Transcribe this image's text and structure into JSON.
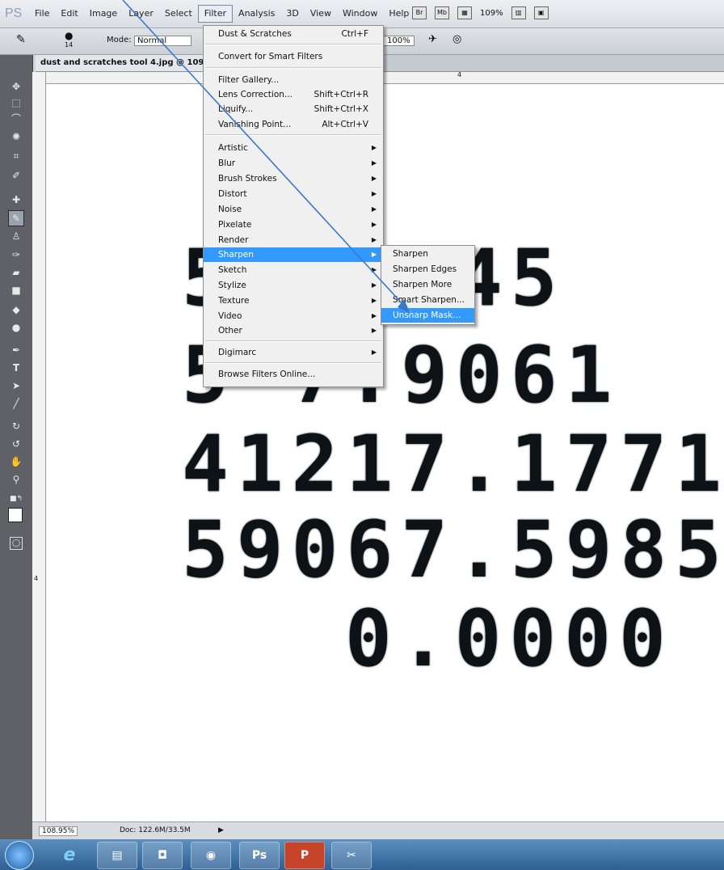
{
  "app": {
    "logo": "PS"
  },
  "menubar": {
    "items": [
      "File",
      "Edit",
      "Image",
      "Layer",
      "Select",
      "Filter",
      "Analysis",
      "3D",
      "View",
      "Window",
      "Help"
    ],
    "active": "Filter",
    "icons": {
      "br": "Br",
      "mb": "Mb"
    },
    "zoom": "109%"
  },
  "options": {
    "brush_size": "14",
    "mode_label": "Mode:",
    "mode_value": "Normal",
    "opacity": "100%"
  },
  "document": {
    "tab_title": "dust and scratches tool 4.jpg @ 109% (R"
  },
  "filter_menu": {
    "items": [
      {
        "label": "Dust & Scratches",
        "shortcut": "Ctrl+F"
      },
      {
        "label": "Convert for Smart Filters",
        "shortcut": ""
      },
      {
        "label": "Filter Gallery...",
        "shortcut": ""
      },
      {
        "label": "Lens Correction...",
        "shortcut": "Shift+Ctrl+R"
      },
      {
        "label": "Liquify...",
        "shortcut": "Shift+Ctrl+X"
      },
      {
        "label": "Vanishing Point...",
        "shortcut": "Alt+Ctrl+V"
      },
      {
        "label": "Artistic",
        "shortcut": ""
      },
      {
        "label": "Blur",
        "shortcut": ""
      },
      {
        "label": "Brush Strokes",
        "shortcut": ""
      },
      {
        "label": "Distort",
        "shortcut": ""
      },
      {
        "label": "Noise",
        "shortcut": ""
      },
      {
        "label": "Pixelate",
        "shortcut": ""
      },
      {
        "label": "Render",
        "shortcut": ""
      },
      {
        "label": "Sharpen",
        "shortcut": ""
      },
      {
        "label": "Sketch",
        "shortcut": ""
      },
      {
        "label": "Stylize",
        "shortcut": ""
      },
      {
        "label": "Texture",
        "shortcut": ""
      },
      {
        "label": "Video",
        "shortcut": ""
      },
      {
        "label": "Other",
        "shortcut": ""
      },
      {
        "label": "Digimarc",
        "shortcut": ""
      },
      {
        "label": "Browse Filters Online...",
        "shortcut": ""
      }
    ]
  },
  "sharpen_submenu": {
    "items": [
      "Sharpen",
      "Sharpen Edges",
      "Sharpen More",
      "Smart Sharpen...",
      "Unsharp Mask..."
    ],
    "highlighted": "Unsharp Mask..."
  },
  "canvas_text": {
    "line1": "5 .1645",
    "line2": "5  7.9061",
    "line3": "41217.1771",
    "line4": "59067.5985",
    "line5": "0.0000"
  },
  "ruler": {
    "top_mark": "4",
    "left_mark": "4"
  },
  "status": {
    "zoom": "108.95%",
    "doc": "Doc: 122.6M/33.5M"
  },
  "taskbar": {
    "ps_label": "Ps",
    "ppt_label": "P"
  },
  "accent_colors": {
    "highlight": "#3399ff",
    "arrow": "#3a78c8"
  }
}
